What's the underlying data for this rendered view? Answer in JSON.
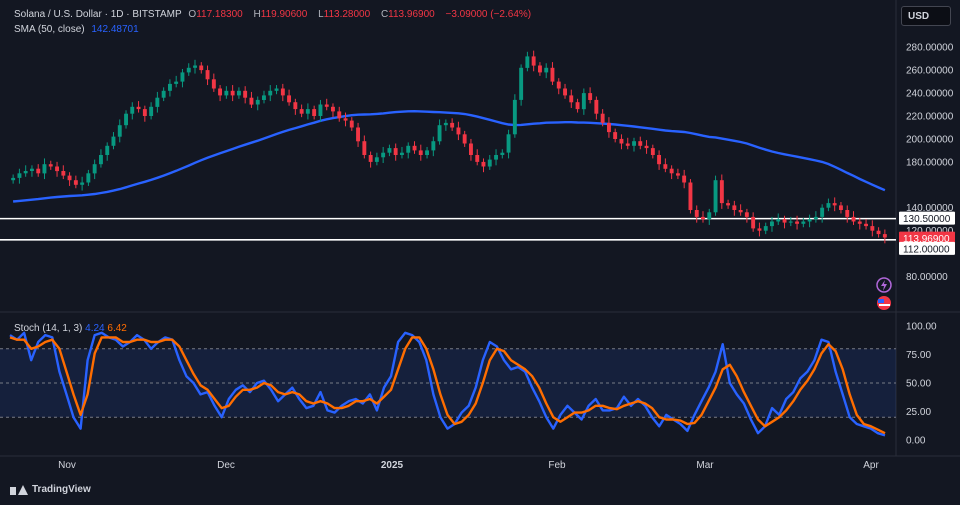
{
  "header": {
    "symbol": "Solana / U.S. Dollar · 1D · BITSTAMP",
    "o_label": "O",
    "o_value": "117.18300",
    "h_label": "H",
    "h_value": "119.90600",
    "l_label": "L",
    "l_value": "113.28000",
    "c_label": "C",
    "c_value": "113.96900",
    "change": "−3.09000 (−2.64%)",
    "sma_label": "SMA (50, close)",
    "sma_value": "142.48701"
  },
  "currency_button": "USD",
  "stoch_panel": {
    "label": "Stoch (14, 1, 3)",
    "k_value": "4.24",
    "d_value": "6.42"
  },
  "branding": "TradingView",
  "colors": {
    "background": "#131722",
    "up": "#089981",
    "down": "#f23645",
    "sma": "#2962ff",
    "stoch_k": "#2962ff",
    "stoch_d": "#ff6d00"
  },
  "price_badges": [
    "130.50000",
    "113.96900",
    "112.00000"
  ],
  "icons": [
    "lightning-alert-icon",
    "us-flag-icon"
  ],
  "chart_data": {
    "type": "candlestick",
    "x_ticks": [
      "Nov",
      "Dec",
      "2025",
      "Feb",
      "Mar",
      "Apr"
    ],
    "price_axis": {
      "ticks": [
        "280.00000",
        "260.00000",
        "240.00000",
        "220.00000",
        "200.00000",
        "180.00000",
        "140.00000",
        "120.00000",
        "80.00000"
      ],
      "tick_values": [
        280,
        260,
        240,
        220,
        200,
        180,
        140,
        120,
        80
      ],
      "range": [
        70,
        295
      ]
    },
    "horizontal_lines": [
      130.5,
      112.0
    ],
    "current_price": 113.969,
    "close": [
      166,
      170,
      172,
      174,
      170,
      178,
      176,
      172,
      168,
      164,
      160,
      162,
      170,
      178,
      186,
      194,
      202,
      212,
      222,
      228,
      226,
      220,
      228,
      236,
      242,
      248,
      250,
      258,
      262,
      264,
      260,
      252,
      244,
      238,
      242,
      238,
      242,
      236,
      230,
      234,
      238,
      242,
      244,
      238,
      232,
      226,
      222,
      226,
      220,
      230,
      228,
      224,
      218,
      216,
      210,
      198,
      186,
      180,
      184,
      188,
      192,
      186,
      188,
      194,
      190,
      186,
      190,
      198,
      212,
      214,
      210,
      204,
      196,
      186,
      180,
      176,
      182,
      186,
      188,
      204,
      234,
      262,
      272,
      264,
      258,
      262,
      250,
      244,
      238,
      232,
      226,
      240,
      234,
      222,
      214,
      206,
      200,
      196,
      194,
      198,
      194,
      192,
      186,
      178,
      174,
      170,
      168,
      162,
      138,
      132,
      130,
      136,
      164,
      144,
      142,
      138,
      136,
      132,
      122,
      120,
      124,
      128,
      130,
      127,
      128,
      126,
      128,
      130,
      132,
      140,
      144,
      142,
      138,
      132,
      128,
      126,
      124,
      120,
      117,
      114
    ],
    "stoch_axis": {
      "ticks": [
        "100.00",
        "75.00",
        "50.00",
        "25.00",
        "0.00"
      ],
      "tick_values": [
        100,
        75,
        50,
        25,
        0
      ],
      "overbought": 80,
      "oversold": 20
    },
    "stoch_k": [
      92,
      88,
      94,
      70,
      86,
      92,
      90,
      60,
      40,
      20,
      10,
      70,
      92,
      94,
      90,
      88,
      82,
      86,
      92,
      88,
      80,
      86,
      90,
      88,
      70,
      56,
      50,
      40,
      42,
      30,
      20,
      36,
      44,
      48,
      42,
      50,
      52,
      44,
      34,
      40,
      46,
      36,
      28,
      30,
      42,
      26,
      24,
      30,
      34,
      36,
      32,
      40,
      26,
      46,
      56,
      86,
      94,
      92,
      86,
      70,
      40,
      20,
      10,
      14,
      24,
      30,
      46,
      70,
      86,
      82,
      70,
      62,
      64,
      60,
      46,
      34,
      20,
      10,
      22,
      30,
      24,
      18,
      30,
      36,
      26,
      26,
      28,
      38,
      30,
      36,
      30,
      20,
      12,
      22,
      18,
      14,
      8,
      22,
      34,
      46,
      60,
      84,
      50,
      40,
      32,
      18,
      6,
      12,
      28,
      22,
      36,
      42,
      54,
      60,
      70,
      88,
      86,
      60,
      40,
      20,
      14,
      12,
      10,
      6,
      4
    ],
    "stoch_d": [
      90,
      88,
      88,
      80,
      82,
      86,
      88,
      80,
      60,
      40,
      22,
      40,
      76,
      90,
      90,
      90,
      86,
      86,
      88,
      88,
      86,
      86,
      88,
      88,
      82,
      70,
      58,
      48,
      44,
      36,
      28,
      30,
      38,
      44,
      44,
      46,
      50,
      48,
      42,
      40,
      42,
      40,
      34,
      32,
      34,
      32,
      28,
      28,
      30,
      34,
      34,
      36,
      32,
      38,
      44,
      62,
      80,
      90,
      90,
      80,
      62,
      40,
      22,
      14,
      16,
      22,
      32,
      50,
      70,
      80,
      78,
      70,
      66,
      62,
      56,
      46,
      32,
      20,
      16,
      20,
      24,
      24,
      26,
      30,
      30,
      28,
      27,
      30,
      32,
      34,
      32,
      28,
      20,
      18,
      18,
      17,
      14,
      15,
      22,
      34,
      46,
      62,
      66,
      56,
      42,
      30,
      18,
      12,
      16,
      20,
      26,
      34,
      44,
      52,
      62,
      76,
      84,
      78,
      62,
      40,
      22,
      14,
      12,
      9,
      6
    ]
  }
}
